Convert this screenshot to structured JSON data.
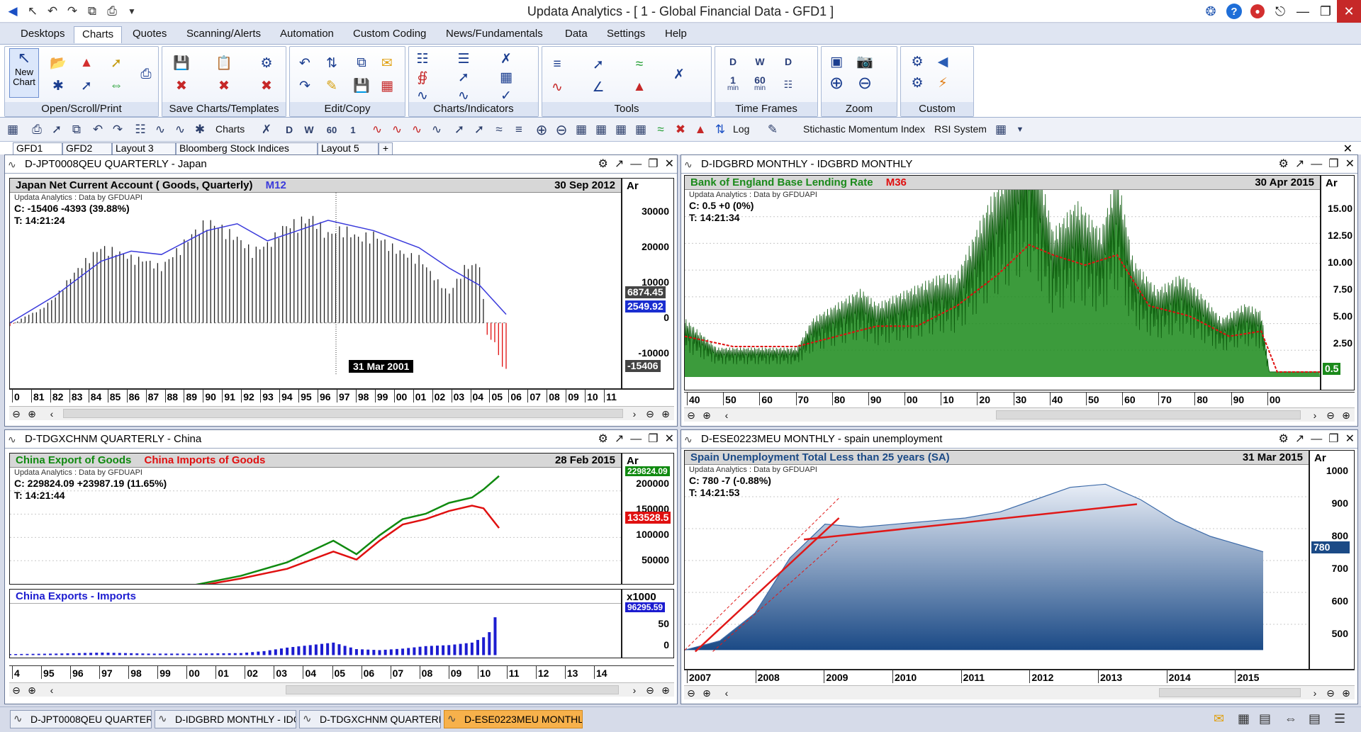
{
  "window": {
    "title": "Updata Analytics - [ 1 - Global Financial Data - GFD1 ]"
  },
  "menu_tabs": [
    "Desktops",
    "Charts",
    "Quotes",
    "Scanning/Alerts",
    "Automation",
    "Custom Coding",
    "News/Fundamentals",
    "Data",
    "Settings",
    "Help"
  ],
  "active_menu_tab": "Charts",
  "ribbon": {
    "new_chart_label": "New Chart",
    "groups": [
      "Open/Scroll/Print",
      "Save Charts/Templates",
      "Edit/Copy",
      "Charts/Indicators",
      "Tools",
      "Time Frames",
      "Zoom",
      "Custom"
    ],
    "timeframe_labels": {
      "d": "D",
      "w": "W",
      "one": "1",
      "sixty": "60",
      "min": "min"
    }
  },
  "toolbar": {
    "charts_label": "Charts",
    "stochastic_label": "Stichastic Momentum Index",
    "rsi_label": "RSI System",
    "log_label": "Log"
  },
  "desktop_tabs": [
    "GFD1",
    "GFD2",
    "Layout 3",
    "Bloomberg Stock Indices",
    "Layout 5"
  ],
  "add_tab_label": "+",
  "panels": [
    {
      "window_title": "D-JPT0008QEU QUARTERLY - Japan",
      "chart_title": "Japan Net Current Account ( Goods, Quarterly)",
      "chart_title_extra": "M12",
      "date": "30 Sep 2012",
      "attribution": "Updata Analytics : Data by GFDUAPI",
      "info_c": "C: -15406  -4393 (39.88%)",
      "info_t": "T: 14:21:24",
      "scale_head": "Ar",
      "scale_labels": [
        "30000",
        "20000",
        "10000",
        "0",
        "-10000"
      ],
      "flags": [
        "6874.45",
        "2549.92",
        "-15406"
      ],
      "cursor_label": "31 Mar 2001",
      "x_labels": [
        "0",
        "81",
        "82",
        "83",
        "84",
        "85",
        "86",
        "87",
        "88",
        "89",
        "90",
        "91",
        "92",
        "93",
        "94",
        "95",
        "96",
        "97",
        "98",
        "99",
        "00",
        "01",
        "02",
        "03",
        "04",
        "05",
        "06",
        "07",
        "08",
        "09",
        "10",
        "11"
      ]
    },
    {
      "window_title": "D-IDGBRD MONTHLY - IDGBRD MONTHLY",
      "chart_title": "Bank of England Base Lending Rate",
      "chart_title_extra": "M36",
      "date": "30 Apr 2015",
      "attribution": "Updata Analytics : Data by GFDUAPI",
      "info_c": "C: 0.5  +0 (0%)",
      "info_t": "T: 14:21:34",
      "scale_head": "Ar",
      "scale_labels": [
        "15.00",
        "12.50",
        "10.00",
        "7.50",
        "5.00",
        "2.50"
      ],
      "flags": [
        "0.5"
      ],
      "x_labels": [
        "40",
        "50",
        "60",
        "70",
        "80",
        "90",
        "00",
        "10",
        "20",
        "30",
        "40",
        "50",
        "60",
        "70",
        "80",
        "90",
        "00"
      ]
    },
    {
      "window_title": "D-TDGXCHNM QUARTERLY - China",
      "chart_title": "China Export of Goods",
      "chart_title_extra": "China Imports of Goods",
      "date": "28 Feb 2015",
      "attribution": "Updata Analytics : Data by GFDUAPI",
      "info_c": "C: 229824.09  +23987.19 (11.65%)",
      "info_t": "T: 14:21:44",
      "scale_head": "Ar",
      "scale_labels": [
        "200000",
        "150000",
        "100000",
        "50000"
      ],
      "flags": [
        "229824.09",
        "133528.5"
      ],
      "sub_title": "China Exports - Imports",
      "sub_scale_head": "x1000",
      "sub_scale_labels": [
        "50",
        "0"
      ],
      "sub_flag": "96295.59",
      "x_labels": [
        "4",
        "95",
        "96",
        "97",
        "98",
        "99",
        "00",
        "01",
        "02",
        "03",
        "04",
        "05",
        "06",
        "07",
        "08",
        "09",
        "10",
        "11",
        "12",
        "13",
        "14"
      ]
    },
    {
      "window_title": "D-ESE0223MEU MONTHLY - spain unemployment",
      "chart_title": "Spain Unemployment Total Less than 25 years (SA)",
      "date": "31 Mar 2015",
      "attribution": "Updata Analytics : Data by GFDUAPI",
      "info_c": "C: 780  -7 (-0.88%)",
      "info_t": "T: 14:21:53",
      "scale_head": "Ar",
      "scale_labels": [
        "1000",
        "900",
        "800",
        "700",
        "600",
        "500"
      ],
      "flags": [
        "780"
      ],
      "x_labels": [
        "2007",
        "2008",
        "2009",
        "2010",
        "2011",
        "2012",
        "2013",
        "2014",
        "2015"
      ]
    }
  ],
  "taskbar": [
    "D-JPT0008QEU QUARTERLY",
    "D-IDGBRD MONTHLY - IDGBRD MONTHLY",
    "D-TDGXCHNM QUARTERLY - China",
    "D-ESE0223MEU MONTHLY"
  ],
  "colors": {
    "japan_ma": "#3a3adb",
    "boe_fill": "#1a8a1a",
    "boe_ma": "#e01010",
    "exports": "#108a10",
    "imports": "#e01010",
    "diff_bars": "#1c1cd0",
    "spain_fill": "#1b4a86",
    "trendline": "#e01818"
  },
  "chart_data": [
    {
      "type": "bar",
      "title": "Japan Net Current Account ( Goods, Quarterly)",
      "x_range": [
        1980,
        2012.75
      ],
      "ylim": [
        -15000,
        36000
      ],
      "series": [
        {
          "name": "Japan Net Current Account ( Goods, Quarterly)",
          "x": [
            1980,
            1981,
            1982,
            1983,
            1984,
            1985,
            1986,
            1987,
            1988,
            1989,
            1990,
            1991,
            1992,
            1993,
            1994,
            1995,
            1996,
            1997,
            1998,
            1999,
            2000,
            2001,
            2002,
            2003,
            2004,
            2005,
            2006,
            2007,
            2008,
            2009,
            2010,
            2011,
            2011.5,
            2012,
            2012.25,
            2012.5,
            2012.75
          ],
          "values": [
            -1000,
            2000,
            4000,
            8000,
            14000,
            19000,
            23000,
            22000,
            20000,
            19000,
            17000,
            22000,
            27000,
            31000,
            29000,
            26000,
            22000,
            24000,
            29000,
            31000,
            32000,
            27000,
            29000,
            26000,
            27000,
            24000,
            21000,
            20000,
            14000,
            9000,
            17000,
            18000,
            -4000,
            -6000,
            -10000,
            -13000,
            -15406
          ]
        },
        {
          "name": "M12",
          "x": [
            1980,
            1983,
            1986,
            1988,
            1990,
            1993,
            1995,
            1997,
            1999,
            2001,
            2004,
            2007,
            2009,
            2011,
            2012.75
          ],
          "values": [
            0,
            8000,
            18000,
            21000,
            20000,
            27000,
            29000,
            24000,
            27000,
            30000,
            27000,
            22000,
            16000,
            11000,
            2500
          ]
        }
      ]
    },
    {
      "type": "area",
      "title": "Bank of England Base Lending Rate",
      "x_range": [
        1936,
        2015.33
      ],
      "ylim": [
        0,
        17
      ],
      "series": [
        {
          "name": "Bank of England Base Lending Rate",
          "x": [
            1936,
            1940,
            1945,
            1950,
            1952,
            1955,
            1958,
            1960,
            1964,
            1968,
            1970,
            1974,
            1976,
            1979,
            1980,
            1982,
            1985,
            1988,
            1990,
            1992,
            1995,
            1998,
            2000,
            2003,
            2006,
            2008,
            2009,
            2015.33
          ],
          "values": [
            4,
            2,
            2,
            2,
            4,
            5,
            6,
            5,
            6,
            7,
            7,
            12,
            14,
            17,
            15,
            10,
            12,
            10,
            14,
            8,
            6,
            7,
            6,
            4,
            5,
            4.5,
            0.5,
            0.5
          ]
        },
        {
          "name": "M36",
          "x": [
            1936,
            1942,
            1950,
            1955,
            1960,
            1965,
            1970,
            1975,
            1979,
            1982,
            1986,
            1990,
            1994,
            1999,
            2004,
            2008,
            2010,
            2015.33
          ],
          "values": [
            4,
            3,
            3,
            4,
            5,
            5,
            7,
            10,
            13,
            12,
            11,
            12,
            7,
            6,
            4,
            4.5,
            0.5,
            0.5
          ]
        }
      ]
    },
    {
      "type": "line",
      "title": "China Export of Goods / China Imports of Goods",
      "x_range": [
        1994,
        2015.17
      ],
      "ylim": [
        30000,
        240000
      ],
      "series": [
        {
          "name": "China Export of Goods",
          "x": [
            1994,
            1996,
            1998,
            2000,
            2002,
            2004,
            2006,
            2008,
            2009,
            2010,
            2011,
            2012,
            2013,
            2014,
            2014.5,
            2015.17
          ],
          "values": [
            10000,
            12000,
            15000,
            20000,
            28000,
            45000,
            70000,
            110000,
            85000,
            120000,
            150000,
            160000,
            180000,
            190000,
            205000,
            229824
          ]
        },
        {
          "name": "China Imports of Goods",
          "x": [
            1994,
            1996,
            1998,
            2000,
            2002,
            2004,
            2006,
            2008,
            2009,
            2010,
            2011,
            2012,
            2013,
            2014,
            2014.5,
            2015.17
          ],
          "values": [
            9000,
            11000,
            12000,
            18000,
            25000,
            40000,
            58000,
            90000,
            75000,
            110000,
            140000,
            150000,
            165000,
            175000,
            170000,
            133528
          ]
        }
      ]
    },
    {
      "type": "bar",
      "title": "China Exports - Imports",
      "x_range": [
        1994,
        2015.17
      ],
      "ylim": [
        -5,
        100
      ],
      "series": [
        {
          "name": "China Exports - Imports",
          "x": [
            1994,
            1996,
            1998,
            2000,
            2002,
            2004,
            2005,
            2006,
            2007,
            2008,
            2009,
            2010,
            2011,
            2012,
            2013,
            2014,
            2014.7,
            2015.17
          ],
          "values": [
            2,
            3,
            5,
            3,
            3,
            4,
            8,
            15,
            20,
            25,
            12,
            10,
            13,
            18,
            20,
            25,
            40,
            96
          ]
        }
      ]
    },
    {
      "type": "area",
      "title": "Spain Unemployment Total Less than 25 years (SA)",
      "x_range": [
        2007,
        2015.25
      ],
      "ylim": [
        440,
        1040
      ],
      "series": [
        {
          "name": "Spain Unemployment Total Less than 25 years (SA)",
          "x": [
            2007,
            2007.5,
            2008,
            2008.5,
            2009,
            2009.5,
            2010,
            2010.5,
            2011,
            2011.5,
            2012,
            2012.5,
            2013,
            2013.5,
            2014,
            2014.5,
            2015.25
          ],
          "values": [
            460,
            490,
            580,
            760,
            870,
            860,
            870,
            880,
            890,
            910,
            950,
            990,
            1000,
            950,
            880,
            830,
            780
          ]
        }
      ]
    }
  ]
}
